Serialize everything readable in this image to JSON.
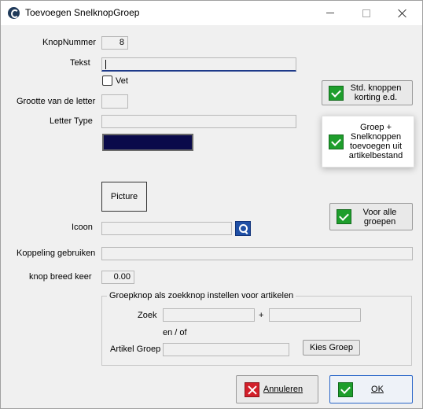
{
  "window": {
    "title": "Toevoegen SnelknopGroep"
  },
  "form": {
    "knopnummer_label": "KnopNummer",
    "knopnummer_value": "8",
    "tekst_label": "Tekst",
    "tekst_value": "",
    "vet_label": "Vet",
    "grootte_label": "Grootte van de letter",
    "grootte_value": "",
    "lettertype_label": "Letter Type",
    "lettertype_value": "",
    "color_value": "#0a0a4a",
    "picture_button": "Picture",
    "icoon_label": "Icoon",
    "icoon_value": "",
    "koppeling_label": "Koppeling gebruiken",
    "koppeling_value": "",
    "breed_label": "knop breed keer",
    "breed_value": "0.00"
  },
  "side_buttons": {
    "std": "Std. knoppen korting e.d.",
    "groep": "Groep + Snelknoppen toevoegen uit artikelbestand",
    "voor_alle": "Voor alle groepen"
  },
  "groupbox": {
    "legend": "Groepknop als zoekknop instellen voor artikelen",
    "zoek_label": "Zoek",
    "zoek_value1": "",
    "plus": "+",
    "zoek_value2": "",
    "enof": "en / of",
    "artikelgroep_label": "Artikel Groep",
    "artikelgroep_value": "",
    "kies_groep": "Kies Groep"
  },
  "footer": {
    "annuleren": "Annuleren",
    "ok": "OK"
  }
}
